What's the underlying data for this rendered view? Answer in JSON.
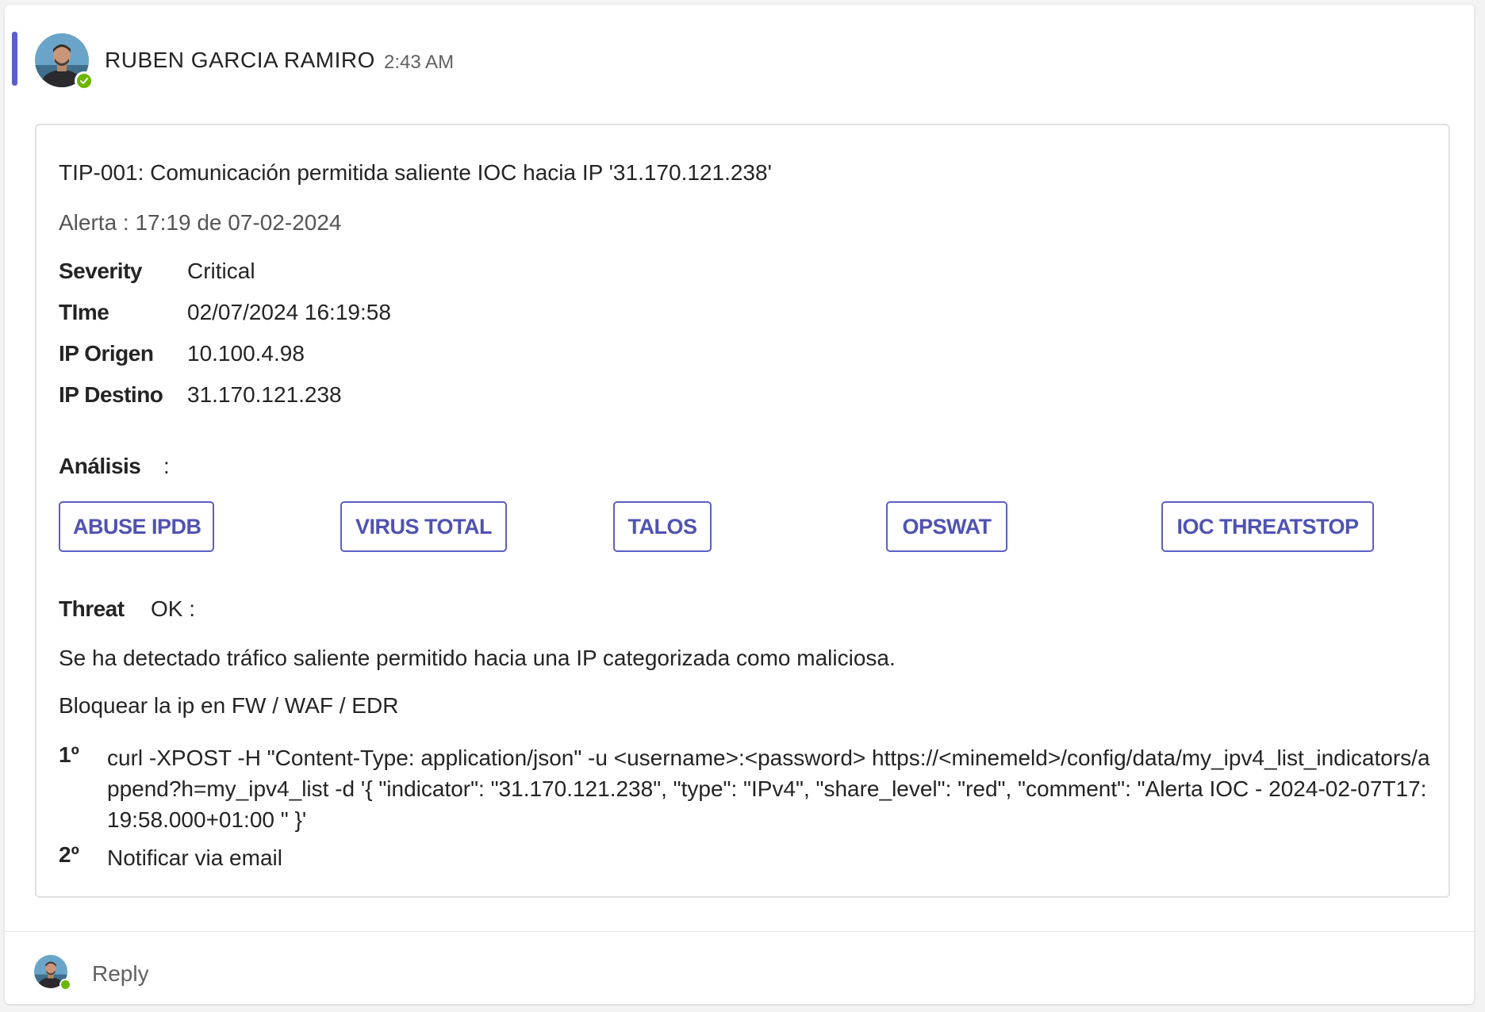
{
  "post": {
    "author": "RUBEN GARCIA RAMIRO",
    "time": "2:43 AM"
  },
  "card": {
    "title": "TIP-001: Comunicación permitida saliente IOC hacia IP '31.170.121.238'",
    "subtitle": "Alerta : 17:19 de 07-02-2024",
    "facts": [
      {
        "key": "Severity",
        "value": "Critical"
      },
      {
        "key": "TIme",
        "value": "02/07/2024 16:19:58"
      },
      {
        "key": "IP Origen",
        "value": "10.100.4.98"
      },
      {
        "key": "IP Destino",
        "value": "31.170.121.238"
      }
    ],
    "analysis_label": "Análisis",
    "analysis_sep": ":",
    "actions": [
      "ABUSE IPDB",
      "VIRUS TOTAL",
      "TALOS",
      "OPSWAT",
      "IOC THREATSTOP"
    ],
    "threat_key": "Threat",
    "threat_value": "OK :",
    "detection_text": "Se ha detectado tráfico saliente permitido hacia una IP categorizada como maliciosa.",
    "recommendation_text": "Bloquear la ip en FW / WAF / EDR",
    "steps": [
      {
        "num": "1º",
        "text": "curl -XPOST -H \"Content-Type: application/json\" -u <username>:<password> https://<minemeld>/config/data/my_ipv4_list_indicators/append?h=my_ipv4_list -d '{ \"indicator\": \"31.170.121.238\", \"type\": \"IPv4\", \"share_level\": \"red\", \"comment\": \"Alerta IOC - 2024-02-07T17:19:58.000+01:00 \" }'"
      },
      {
        "num": "2º",
        "text": "Notificar via email"
      }
    ]
  },
  "reply": {
    "label": "Reply"
  },
  "icons": {
    "presence": "available-check-icon",
    "avatar": "user-avatar-icon"
  },
  "colors": {
    "accent": "#5b5fc7",
    "button_text": "#4f52b2",
    "presence": "#6bb700",
    "text": "#242424",
    "muted": "#616161"
  }
}
